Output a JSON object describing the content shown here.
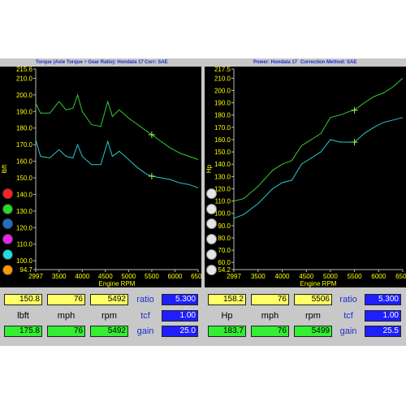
{
  "colors": {
    "torque_upper": "#33cc33",
    "torque_lower": "#22cccc",
    "axis_text": "#ffff00",
    "panel_bg": "#c8c8c8",
    "title_text": "#1a2fcc",
    "yellow_box": "#ffff66",
    "green_box": "#33ee33",
    "blue_box": "#1e1eff"
  },
  "left_panel": {
    "title_a": "Torque (Axle Torque ÷ Gear Ratio): Hondata 17",
    "title_b": "Corr: SAE",
    "ylabel": "lbft",
    "xlabel": "Engine RPM",
    "color_circles": [
      "red",
      "green",
      "blue",
      "magenta",
      "cyan",
      "orange"
    ],
    "readouts": {
      "row1": {
        "v1": "150.8",
        "v2": "76",
        "v3": "5492",
        "label": "ratio",
        "v4": "5.300"
      },
      "row2": {
        "l1": "lbft",
        "l2": "mph",
        "l3": "rpm",
        "label": "tcf",
        "v4": "1.00"
      },
      "row3": {
        "v1": "175.8",
        "v2": "76",
        "v3": "5492",
        "label": "gain",
        "v4": "25.0"
      }
    }
  },
  "right_panel": {
    "title_a": "Power: Hondata 17",
    "title_b": "Correction Method: SAE",
    "ylabel": "Hp",
    "xlabel": "Engine RPM",
    "readouts": {
      "row1": {
        "v1": "158.2",
        "v2": "76",
        "v3": "5506",
        "label": "ratio",
        "v4": "5.300"
      },
      "row2": {
        "l1": "Hp",
        "l2": "mph",
        "l3": "rpm",
        "label": "tcf",
        "v4": "1.00"
      },
      "row3": {
        "v1": "183.7",
        "v2": "76",
        "v3": "5499",
        "label": "gain",
        "v4": "25.5"
      }
    }
  },
  "chart_data": [
    {
      "type": "line",
      "xlabel": "Engine RPM",
      "ylabel": "lbft",
      "xlim": [
        2997,
        6500
      ],
      "ylim": [
        94.7,
        215.6
      ],
      "xticks": [
        "2997",
        "3500",
        "4000",
        "4500",
        "5000",
        "5500",
        "6000",
        "6500"
      ],
      "yticks": [
        "215.6",
        "210.0",
        "200.0",
        "190.0",
        "180.0",
        "170.0",
        "160.0",
        "150.0",
        "140.0",
        "130.0",
        "120.0",
        "110.0",
        "100.0",
        "94.7"
      ],
      "grid": false,
      "series": [
        {
          "x": [
            2997,
            3100,
            3300,
            3500,
            3650,
            3800,
            3900,
            4000,
            4200,
            4400,
            4550,
            4650,
            4800,
            5000,
            5200,
            5400,
            5500,
            5700,
            5900,
            6100,
            6300,
            6500
          ],
          "y": [
            195,
            189,
            189,
            196,
            191,
            192,
            200,
            190,
            182,
            181,
            196,
            187,
            191,
            186,
            182,
            178,
            176,
            172,
            168,
            165,
            163,
            161
          ]
        },
        {
          "x": [
            2997,
            3100,
            3300,
            3500,
            3650,
            3800,
            3900,
            4000,
            4200,
            4400,
            4550,
            4650,
            4800,
            5000,
            5200,
            5400,
            5500,
            5700,
            5900,
            6100,
            6300,
            6500
          ],
          "y": [
            173,
            163,
            162,
            167,
            163,
            162,
            170,
            163,
            158,
            158,
            172,
            163,
            166,
            161,
            156,
            152,
            151,
            150,
            149,
            147,
            146,
            144
          ]
        }
      ],
      "markers": [
        {
          "x": 5500,
          "y": 176
        },
        {
          "x": 5500,
          "y": 151
        }
      ]
    },
    {
      "type": "line",
      "xlabel": "Engine RPM",
      "ylabel": "Hp",
      "xlim": [
        2997,
        6500
      ],
      "ylim": [
        54.2,
        217.5
      ],
      "xticks": [
        "2997",
        "3500",
        "4000",
        "4500",
        "5000",
        "5500",
        "6000",
        "6500"
      ],
      "yticks": [
        "217.5",
        "210.0",
        "200.0",
        "190.0",
        "180.0",
        "170.0",
        "160.0",
        "150.0",
        "140.0",
        "130.0",
        "120.0",
        "110.0",
        "100.0",
        "90.0",
        "80.0",
        "70.0",
        "60.0",
        "54.2"
      ],
      "grid": false,
      "series": [
        {
          "x": [
            2997,
            3200,
            3500,
            3800,
            4000,
            4200,
            4400,
            4600,
            4800,
            5000,
            5200,
            5400,
            5500,
            5700,
            5900,
            6100,
            6300,
            6500
          ],
          "y": [
            110,
            112,
            122,
            135,
            140,
            143,
            155,
            160,
            165,
            178,
            180,
            183,
            184,
            190,
            195,
            198,
            203,
            210
          ]
        },
        {
          "x": [
            2997,
            3200,
            3500,
            3800,
            4000,
            4200,
            4400,
            4600,
            4800,
            5000,
            5200,
            5400,
            5500,
            5700,
            5900,
            6100,
            6300,
            6500
          ],
          "y": [
            96,
            99,
            108,
            120,
            125,
            127,
            140,
            145,
            150,
            160,
            158,
            158,
            158,
            165,
            170,
            174,
            176,
            178
          ]
        }
      ],
      "markers": [
        {
          "x": 5500,
          "y": 184
        },
        {
          "x": 5500,
          "y": 158
        }
      ]
    }
  ]
}
